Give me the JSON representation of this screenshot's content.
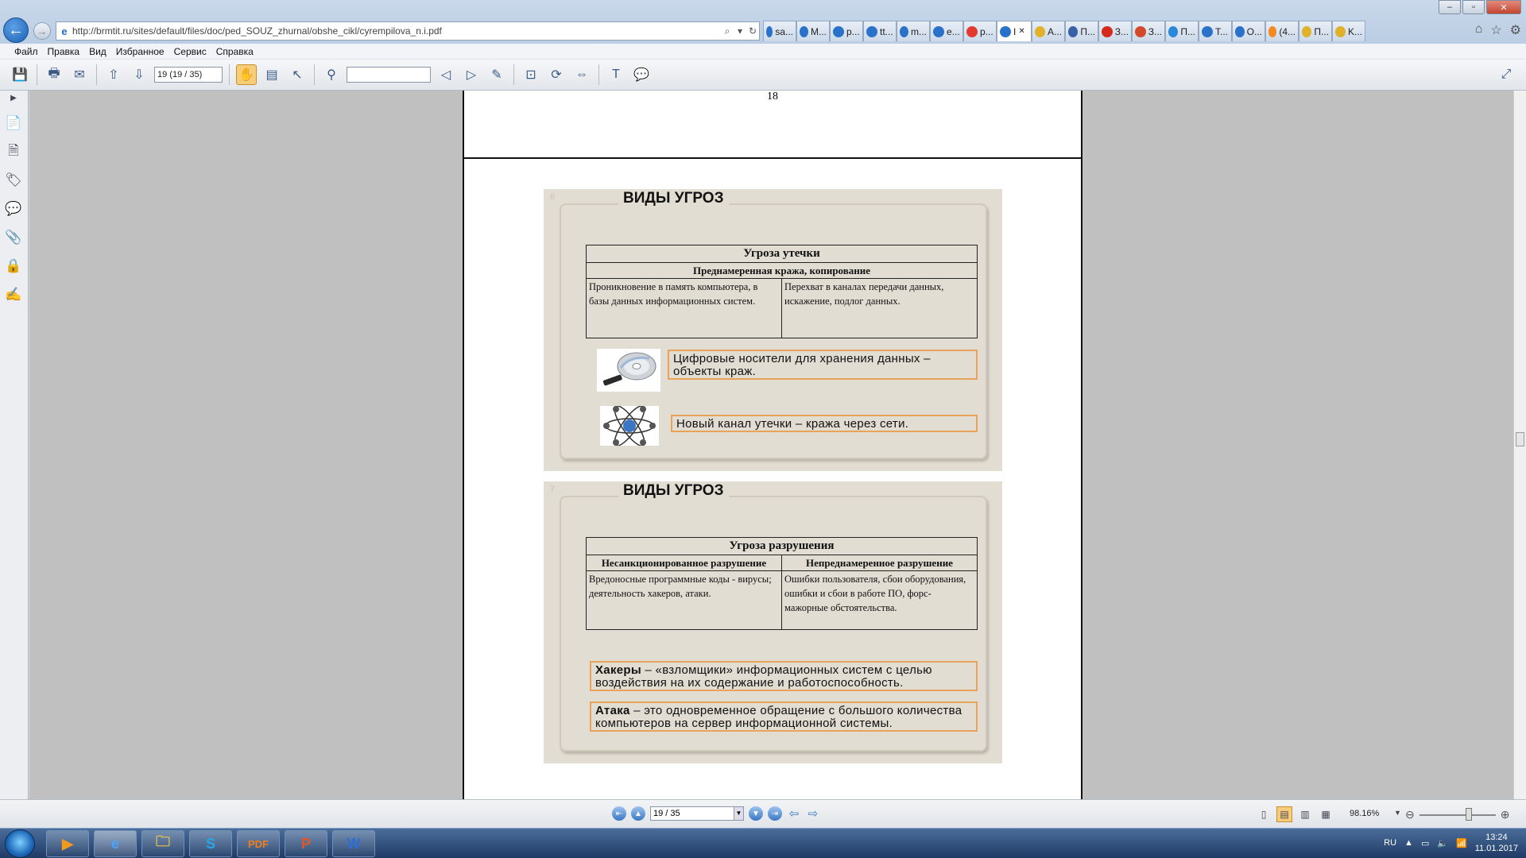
{
  "browser": {
    "address_url": "http://brmtit.ru/sites/default/files/doc/ped_SOUZ_zhurnal/obshe_cikl/cyrempilova_n.i.pdf",
    "tabs": [
      {
        "label": "sa...",
        "icon": "ie-icon",
        "color": "#2a72c9"
      },
      {
        "label": "M...",
        "icon": "ie-icon",
        "color": "#2a72c9"
      },
      {
        "label": "p...",
        "icon": "ie-icon",
        "color": "#2a72c9"
      },
      {
        "label": "tt...",
        "icon": "ie-icon",
        "color": "#2a72c9"
      },
      {
        "label": "m...",
        "icon": "ie-icon",
        "color": "#2a72c9"
      },
      {
        "label": "e...",
        "icon": "ie-icon",
        "color": "#2a72c9"
      },
      {
        "label": "p...",
        "icon": "yandex-icon",
        "color": "#e23a2f"
      },
      {
        "label": "I",
        "icon": "ie-icon",
        "color": "#2a72c9",
        "active": true,
        "closable": true
      },
      {
        "label": "A...",
        "icon": "info-icon",
        "color": "#e1b12a"
      },
      {
        "label": "П...",
        "icon": "opera-icon",
        "color": "#3a61a8"
      },
      {
        "label": "З...",
        "icon": "youtube-icon",
        "color": "#d52b1e"
      },
      {
        "label": "З...",
        "icon": "red-icon",
        "color": "#d24a2a"
      },
      {
        "label": "П...",
        "icon": "cloud-icon",
        "color": "#2a88d8"
      },
      {
        "label": "T...",
        "icon": "ie-icon",
        "color": "#2a72c9"
      },
      {
        "label": "O...",
        "icon": "ie-icon",
        "color": "#2a72c9"
      },
      {
        "label": "(4...",
        "icon": "ok-icon",
        "color": "#f28a1e"
      },
      {
        "label": "П...",
        "icon": "info-icon",
        "color": "#e1b12a"
      },
      {
        "label": "K...",
        "icon": "info-icon",
        "color": "#e1b12a"
      }
    ],
    "menu": [
      "Файл",
      "Правка",
      "Вид",
      "Избранное",
      "Сервис",
      "Справка"
    ]
  },
  "toolbar": {
    "page_field": "19 (19 / 35)"
  },
  "document": {
    "page_number_top": "18",
    "slide1": {
      "number": "6",
      "title": "ВИДЫ УГРОЗ",
      "table_title": "Угроза утечки",
      "table_subtitle": "Преднамеренная кража, копирование",
      "cell_left": "Проникновение в память компьютера, в базы данных информационных систем.",
      "cell_right": "Перехват в каналах передачи данных, искажение, подлог данных.",
      "box1": "Цифровые носители для хранения данных – объекты краж.",
      "box2": "Новый канал утечки – кража через сети."
    },
    "slide2": {
      "number": "7",
      "title": "ВИДЫ УГРОЗ",
      "table_title": "Угроза разрушения",
      "col_left_header": "Несанкционированное разрушение",
      "col_right_header": "Непреднамеренное разрушение",
      "cell_left": "Вредоносные программные коды - вирусы; деятельность хакеров, атаки.",
      "cell_right": "Ошибки пользователя, сбои оборудования, ошибки и сбои в работе ПО, форс-мажорные обстоятельства.",
      "box1_term": "Хакеры",
      "box1_text": " – «взломщики» информационных систем с целью воздействия на их содержание и работоспособность.",
      "box2_term": "Атака",
      "box2_text": " – это одновременное обращение с большого количества компьютеров на сервер информационной системы."
    }
  },
  "status": {
    "page_field": "19 / 35",
    "zoom": "98.16%"
  },
  "taskbar": {
    "apps": [
      "media-player",
      "internet-explorer",
      "file-explorer",
      "skype",
      "pdf-reader",
      "powerpoint",
      "word"
    ],
    "lang": "RU",
    "time": "13:24",
    "date": "11.01.2017"
  }
}
